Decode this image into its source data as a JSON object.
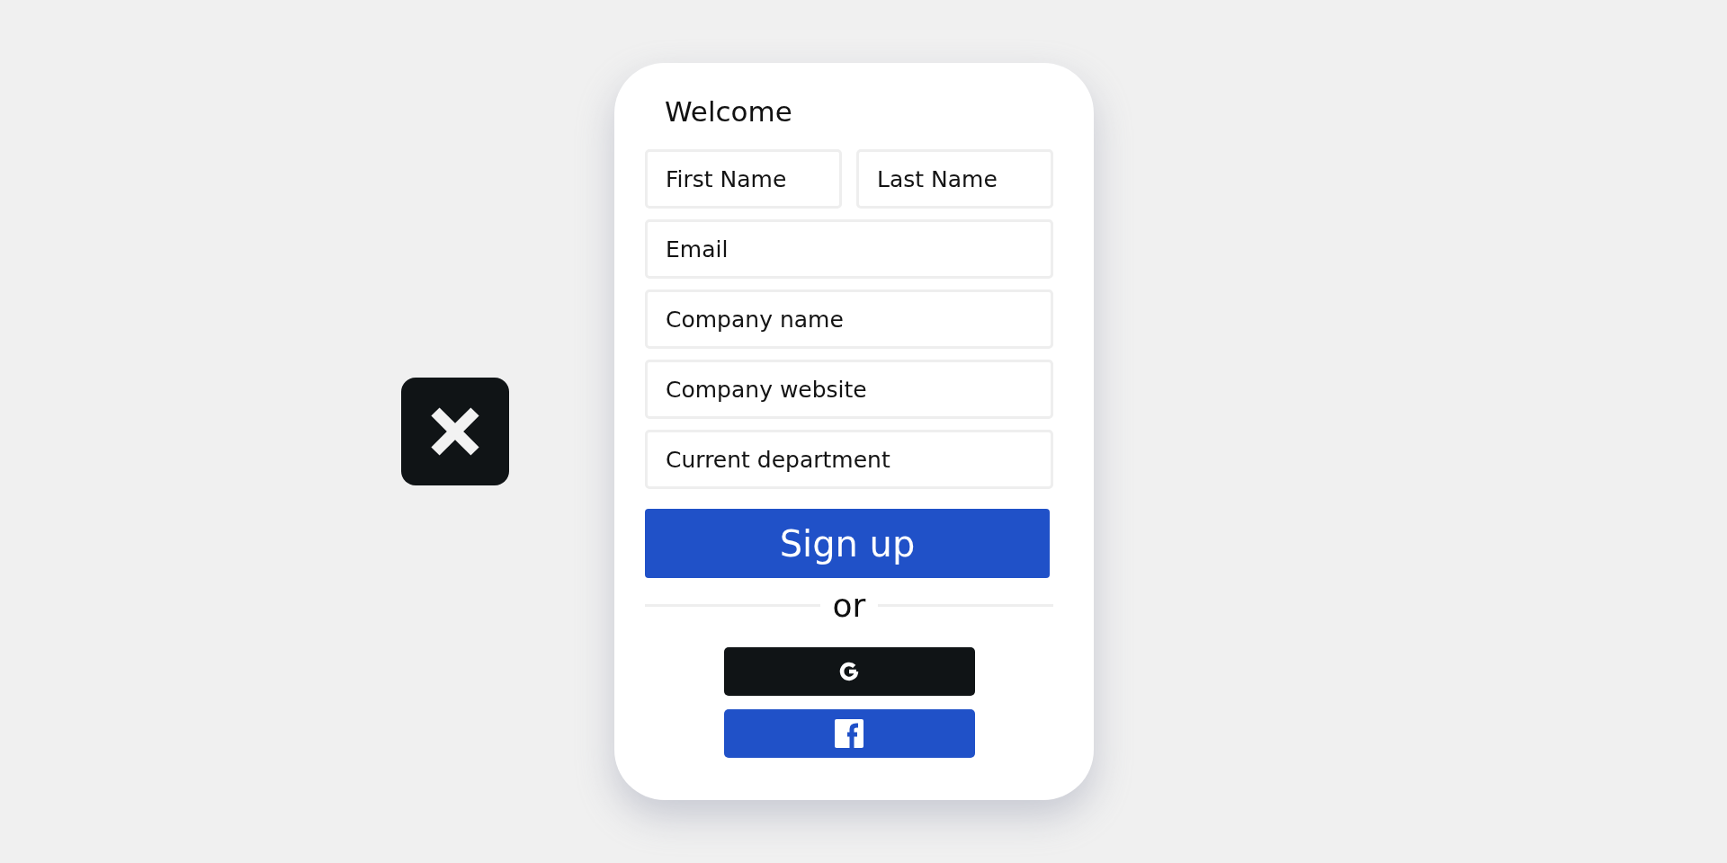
{
  "form": {
    "title": "Welcome",
    "fields": [
      {
        "placeholder": "First Name",
        "kind": "half"
      },
      {
        "placeholder": "Last Name",
        "kind": "half"
      },
      {
        "placeholder": "Email",
        "kind": "full"
      },
      {
        "placeholder": "Company name",
        "kind": "full"
      },
      {
        "placeholder": "Company website",
        "kind": "full"
      },
      {
        "placeholder": "Current department",
        "kind": "full"
      }
    ],
    "submit": "Sign up",
    "separator": "or",
    "social_buttons": [
      {
        "kind": "google"
      },
      {
        "kind": "facebook"
      }
    ]
  }
}
